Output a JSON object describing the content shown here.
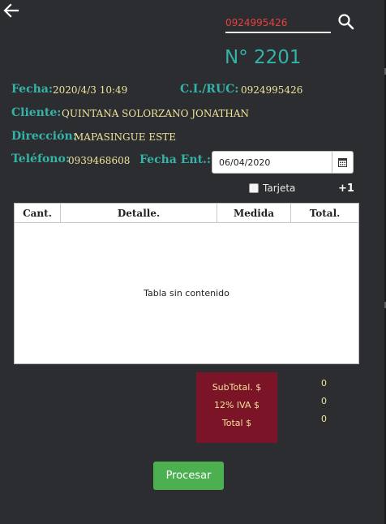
{
  "colors": {
    "accent": "#35b3a8",
    "value_text": "#f2e39b",
    "background": "#2b2d30",
    "totals_bg": "#7b1427",
    "process_bg": "#4caf50",
    "search_text": "#e8413e"
  },
  "header": {
    "back_icon": "arrow-left-icon",
    "search_value": "0924995426",
    "search_icon": "magnifier-icon",
    "order_number": "N° 2201"
  },
  "info": {
    "fecha_label": "Fecha:",
    "fecha_value": "2020/4/3   10:49",
    "ruc_label": "C.I./RUC:",
    "ruc_value": "0924995426",
    "cliente_label": "Cliente:",
    "cliente_value": "QUINTANA SOLORZANO JONATHAN",
    "direccion_label": "Dirección:",
    "direccion_value": "MAPASINGUE ESTE",
    "telefono_label": "Teléfono:",
    "telefono_value": "0939468608",
    "fecha_ent_label": "Fecha Ent.:",
    "fecha_ent_value": "06/04/2020"
  },
  "options": {
    "tarjeta_label": "Tarjeta",
    "tarjeta_checked": false,
    "add_label": "+1"
  },
  "table": {
    "columns": [
      "Cant.",
      "Detalle.",
      "Medida",
      "Total."
    ],
    "rows": [],
    "empty_text": "Tabla sin contenido"
  },
  "totals": {
    "subtotal_label": "SubTotal. $",
    "iva_label": "12% IVA $",
    "total_label": "Total $",
    "subtotal_value": "0",
    "iva_value": "0",
    "total_value": "0"
  },
  "actions": {
    "process_label": "Procesar"
  }
}
